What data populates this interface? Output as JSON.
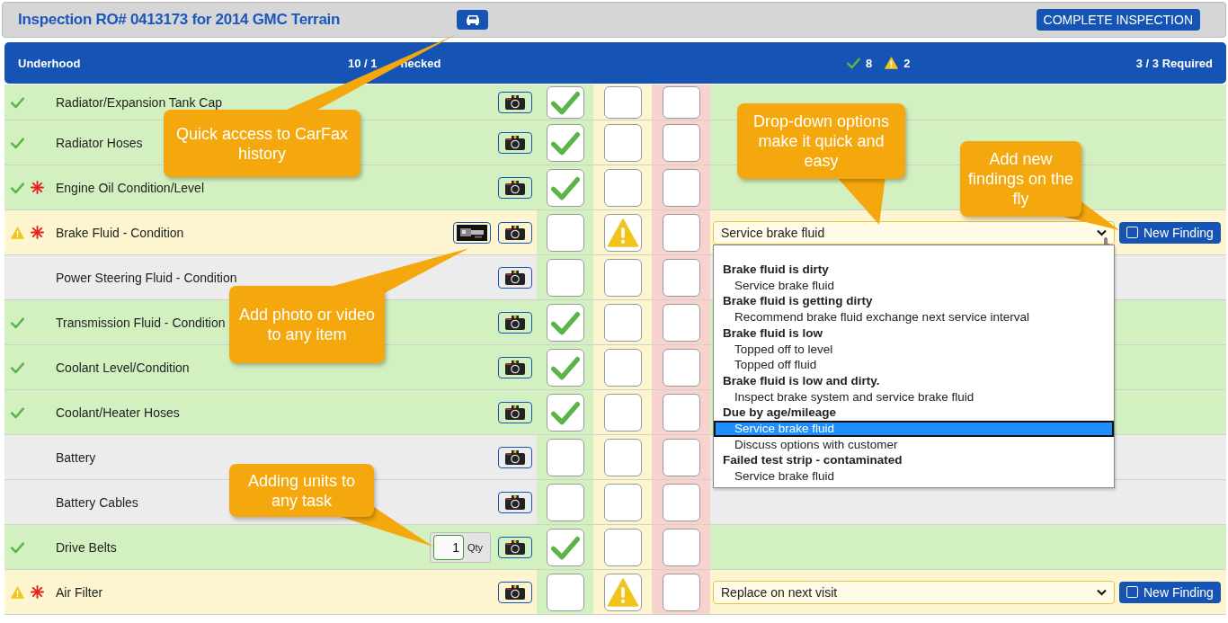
{
  "title": "Inspection RO# 0413173 for 2014 GMC Terrain",
  "complete_button": "COMPLETE INSPECTION",
  "section": {
    "name": "Underhood",
    "progress_parts": [
      "10 / 1",
      "hecked"
    ],
    "ok_count": "8",
    "warn_count": "2",
    "required": "3 / 3 Required"
  },
  "items": [
    {
      "name": "Radiator/Expansion Tank Cap",
      "passed": true,
      "attention": false,
      "required": false,
      "media": false
    },
    {
      "name": "Radiator Hoses",
      "passed": true,
      "attention": false,
      "required": false,
      "media": false
    },
    {
      "name": "Engine Oil Condition/Level",
      "passed": true,
      "attention": false,
      "required": true,
      "media": false
    },
    {
      "name": "Brake Fluid - Condition",
      "passed": false,
      "attention": true,
      "required": true,
      "media": true,
      "finding": "Service brake fluid",
      "new_finding": "New Finding",
      "open": true
    },
    {
      "name": "Power Steering Fluid - Condition",
      "passed": false,
      "attention": false,
      "required": false,
      "media": false
    },
    {
      "name": "Transmission Fluid - Condition",
      "passed": true,
      "attention": false,
      "required": false,
      "media": false
    },
    {
      "name": "Coolant Level/Condition",
      "passed": true,
      "attention": false,
      "required": false,
      "media": false
    },
    {
      "name": "Coolant/Heater Hoses",
      "passed": true,
      "attention": false,
      "required": false,
      "media": false
    },
    {
      "name": "Battery",
      "passed": false,
      "attention": false,
      "required": false,
      "media": false
    },
    {
      "name": "Battery Cables",
      "passed": false,
      "attention": false,
      "required": false,
      "media": false
    },
    {
      "name": "Drive Belts",
      "passed": true,
      "attention": false,
      "required": false,
      "media": false,
      "qty": "1",
      "qty_label": "Qty"
    },
    {
      "name": "Air Filter",
      "passed": false,
      "attention": true,
      "required": true,
      "media": false,
      "finding": "Replace on next visit",
      "new_finding": "New Finding",
      "open": false
    }
  ],
  "dropdown_groups": [
    {
      "label": "Brake fluid is dirty",
      "options": [
        {
          "label": "Service brake fluid",
          "selected": false
        }
      ]
    },
    {
      "label": "Brake fluid is getting dirty",
      "options": [
        {
          "label": "Recommend brake fluid exchange next service interval",
          "selected": false
        }
      ]
    },
    {
      "label": "Brake fluid is low",
      "options": [
        {
          "label": "Topped off to level",
          "selected": false
        },
        {
          "label": "Topped off fluid",
          "selected": false
        }
      ]
    },
    {
      "label": "Brake fluid is low and dirty.",
      "options": [
        {
          "label": "Inspect brake system and service brake fluid",
          "selected": false
        }
      ]
    },
    {
      "label": "Due by age/mileage",
      "options": [
        {
          "label": "Service brake fluid",
          "selected": true
        },
        {
          "label": "Discuss options with customer",
          "selected": false
        }
      ]
    },
    {
      "label": "Failed test strip - contaminated",
      "options": [
        {
          "label": "Service brake fluid",
          "selected": false
        }
      ]
    }
  ],
  "callouts": [
    {
      "text": "Quick access to CarFax history",
      "kind": "carfax"
    },
    {
      "text": "Drop-down options make it quick and easy",
      "kind": "dropdown"
    },
    {
      "text": "Add new findings on the fly",
      "kind": "finding"
    },
    {
      "text": "Add photo or video to any item"
    },
    {
      "text": "Adding units to any task",
      "kind": "units"
    }
  ]
}
